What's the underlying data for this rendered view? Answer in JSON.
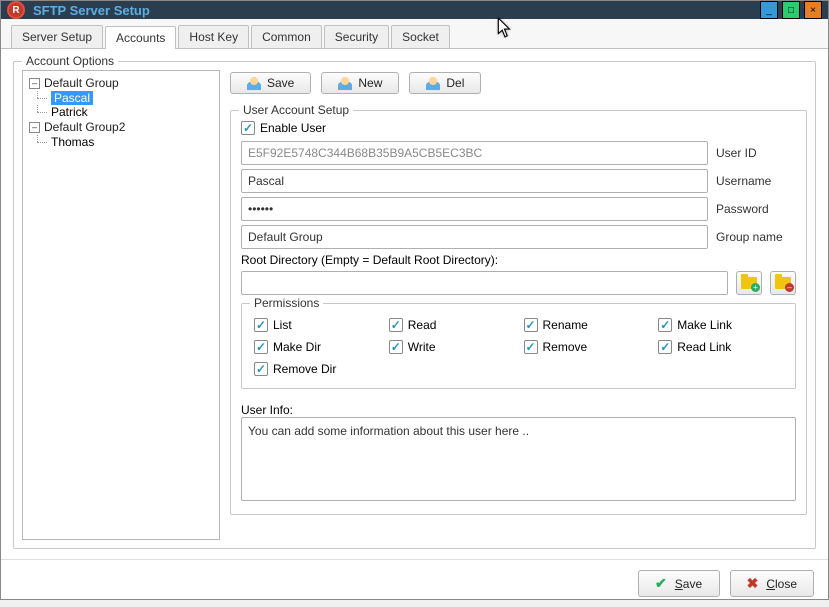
{
  "window": {
    "title": "SFTP Server Setup"
  },
  "winbuttons": {
    "min": "_",
    "max": "□",
    "close": "×"
  },
  "tabs": [
    "Server Setup",
    "Accounts",
    "Host Key",
    "Common",
    "Security",
    "Socket"
  ],
  "active_tab_index": 1,
  "account_options_legend": "Account Options",
  "tree": {
    "groups": [
      {
        "name": "Default Group",
        "expanded": true,
        "children": [
          {
            "name": "Pascal",
            "selected": true
          },
          {
            "name": "Patrick",
            "selected": false
          }
        ]
      },
      {
        "name": "Default Group2",
        "expanded": true,
        "children": [
          {
            "name": "Thomas",
            "selected": false
          }
        ]
      }
    ]
  },
  "toolbar": {
    "save": "Save",
    "new": "New",
    "del": "Del"
  },
  "user_setup_legend": "User Account Setup",
  "enable_user": {
    "label": "Enable User",
    "checked": true
  },
  "fields": {
    "user_id": {
      "value": "E5F92E5748C344B68B35B9A5CB5EC3BC",
      "label": "User ID"
    },
    "username": {
      "value": "Pascal",
      "label": "Username"
    },
    "password": {
      "value": "••••••",
      "label": "Password"
    },
    "group": {
      "value": "Default Group",
      "label": "Group name"
    }
  },
  "root_dir": {
    "label": "Root Directory (Empty = Default Root Directory):",
    "value": ""
  },
  "permissions_legend": "Permissions",
  "permissions": [
    {
      "label": "List",
      "checked": true
    },
    {
      "label": "Read",
      "checked": true
    },
    {
      "label": "Rename",
      "checked": true
    },
    {
      "label": "Make Link",
      "checked": true
    },
    {
      "label": "Make Dir",
      "checked": true
    },
    {
      "label": "Write",
      "checked": true
    },
    {
      "label": "Remove",
      "checked": true
    },
    {
      "label": "Read Link",
      "checked": true
    },
    {
      "label": "Remove Dir",
      "checked": true
    }
  ],
  "user_info": {
    "label": "User Info:",
    "value": "You can add some information about this user here .."
  },
  "footer": {
    "save": "Save",
    "close": "Close"
  }
}
